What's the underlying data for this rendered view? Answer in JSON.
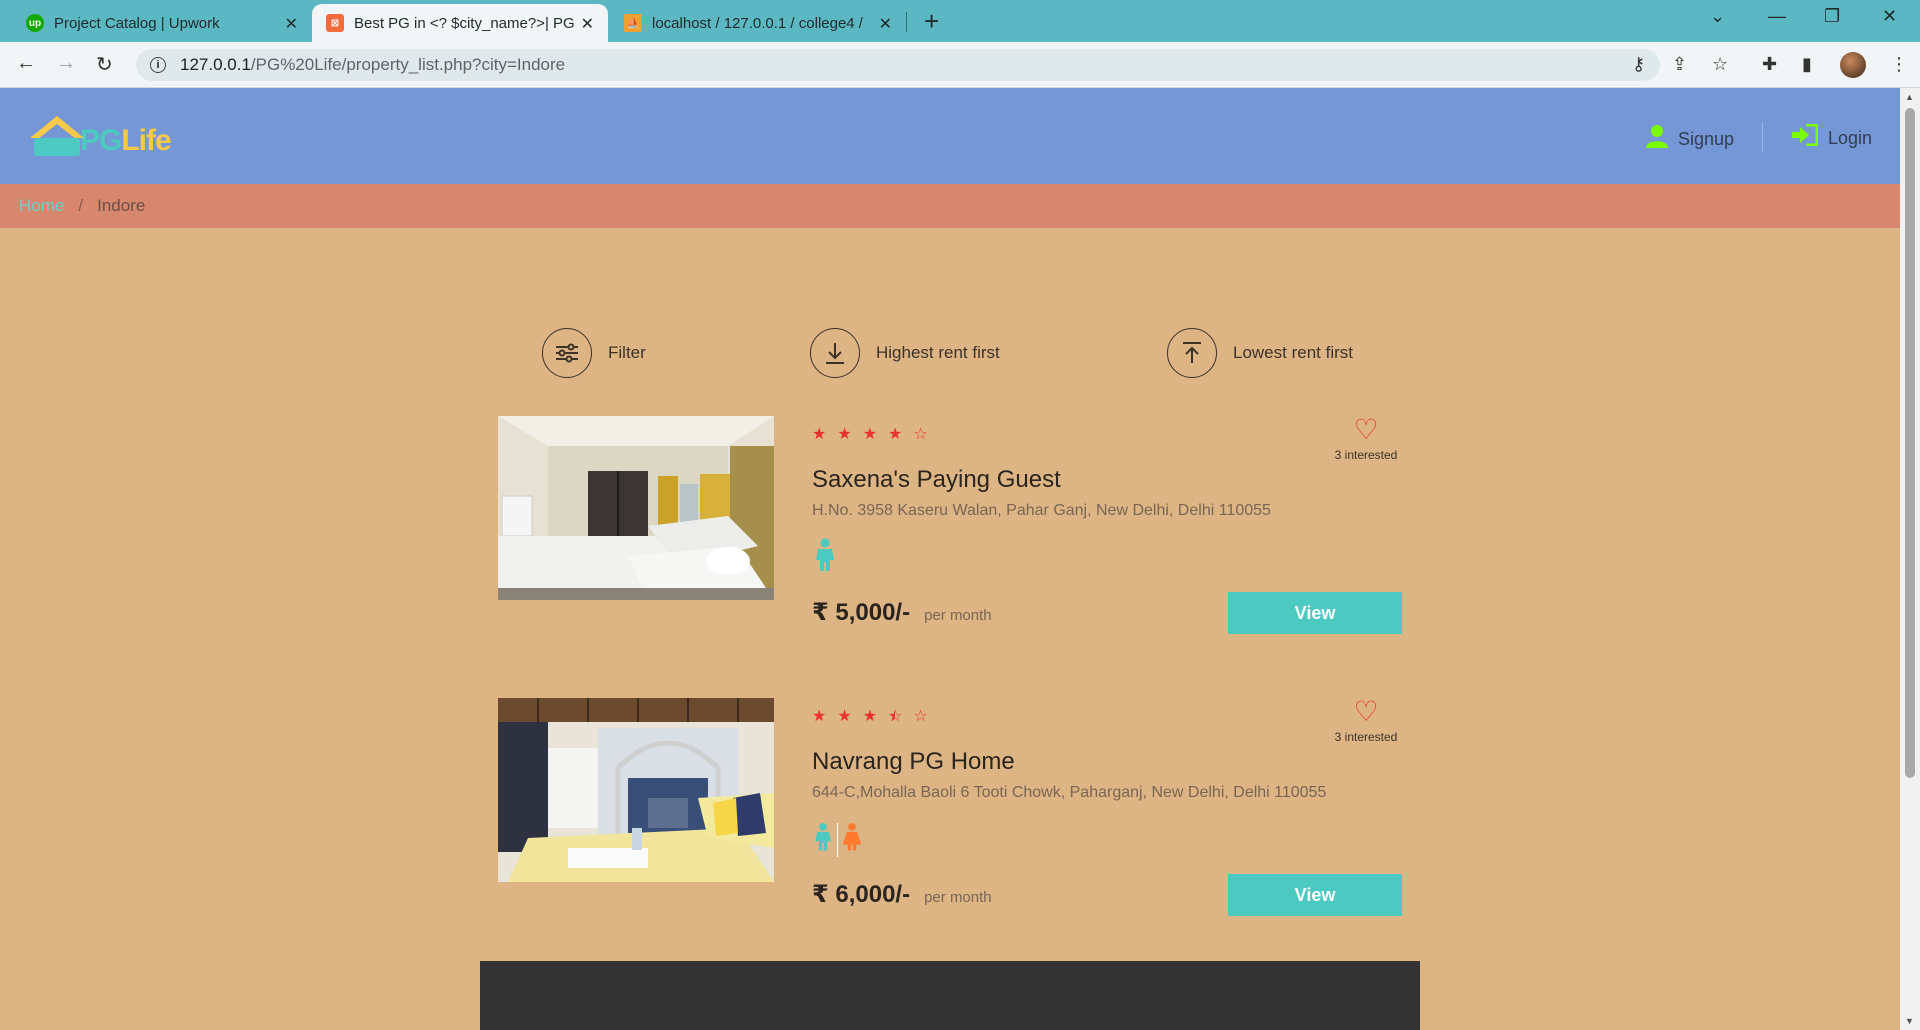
{
  "browser": {
    "tabs": [
      {
        "title": "Project Catalog | Upwork",
        "favicon": "upwork-icon",
        "active": false
      },
      {
        "title": "Best PG in <? $city_name?>| PG L",
        "favicon": "xampp-icon",
        "active": true
      },
      {
        "title": "localhost / 127.0.0.1 / college4 /",
        "favicon": "phpmyadmin-icon",
        "active": false
      }
    ],
    "url_host": "127.0.0.1",
    "url_path": "/PG%20Life/property_list.php?city=Indore"
  },
  "header": {
    "logo_pg": "PG",
    "logo_life": "Life",
    "signup_label": "Signup",
    "login_label": "Login"
  },
  "breadcrumb": {
    "home": "Home",
    "separator": "/",
    "current": "Indore"
  },
  "sort": {
    "filter_label": "Filter",
    "highest_label": "Highest rent first",
    "lowest_label": "Lowest rent first"
  },
  "properties": [
    {
      "name": "Saxena's Paying Guest",
      "address": "H.No. 3958 Kaseru Walan, Pahar Ganj, New Delhi, Delhi 110055",
      "rating": 4,
      "interested": "3 interested",
      "price": "₹ 5,000/-",
      "per": "per month",
      "view_label": "View",
      "gender": [
        "male"
      ]
    },
    {
      "name": "Navrang PG Home",
      "address": "644-C,Mohalla Baoli 6 Tooti Chowk, Paharganj, New Delhi, Delhi 110055",
      "rating": 3.5,
      "interested": "3 interested",
      "price": "₹ 6,000/-",
      "per": "per month",
      "view_label": "View",
      "gender": [
        "male",
        "female"
      ]
    }
  ],
  "colors": {
    "header_bg": "#7697d6",
    "breadcrumb_bg": "#d7876d",
    "page_bg": "#ddb584",
    "accent": "#4cc9c0",
    "star": "#e8322e"
  }
}
